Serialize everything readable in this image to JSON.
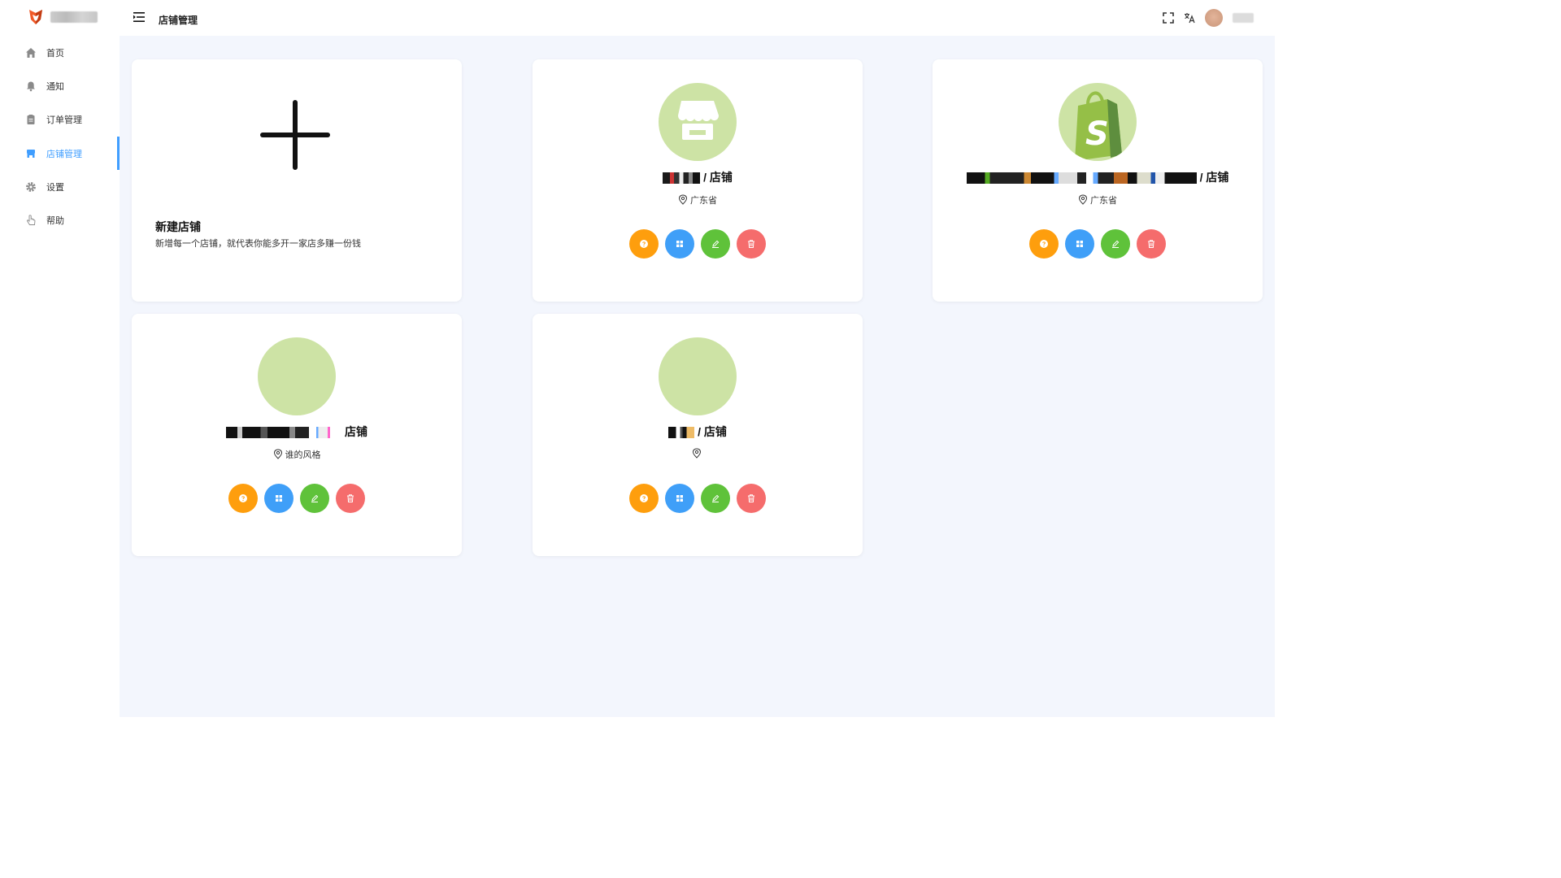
{
  "sidebar": {
    "items": [
      {
        "label": "首页",
        "icon": "home-icon"
      },
      {
        "label": "通知",
        "icon": "bell-icon"
      },
      {
        "label": "订单管理",
        "icon": "clipboard-icon"
      },
      {
        "label": "店铺管理",
        "icon": "store-icon",
        "active": true
      },
      {
        "label": "设置",
        "icon": "gear-icon"
      },
      {
        "label": "帮助",
        "icon": "pointer-hand-icon"
      }
    ]
  },
  "header": {
    "title": "店铺管理",
    "icons": [
      "menu-fold-icon",
      "fullscreen-icon",
      "translate-icon",
      "avatar"
    ]
  },
  "new_store": {
    "title": "新建店铺",
    "description": "新增每一个店铺，就代表你能多开一家店多赚一份钱"
  },
  "stores": [
    {
      "name_suffix": "/ 店铺",
      "location": "广东省",
      "logo": "store-icon"
    },
    {
      "name_suffix": "/ 店铺",
      "location": "广东省",
      "logo": "shopify-icon"
    },
    {
      "name_suffix": "店铺",
      "location": "谁的风格",
      "logo": "blank"
    },
    {
      "name_suffix": "/ 店铺",
      "location": "",
      "logo": "blank"
    }
  ],
  "colors": {
    "accent": "#409eff",
    "help_button": "#fe9e0d",
    "grid_button": "#3f9ff8",
    "edit_button": "#5fc23a",
    "delete_button": "#f56c6c",
    "logo_circle": "#cde3a5",
    "content_bg": "#f3f6fd"
  }
}
